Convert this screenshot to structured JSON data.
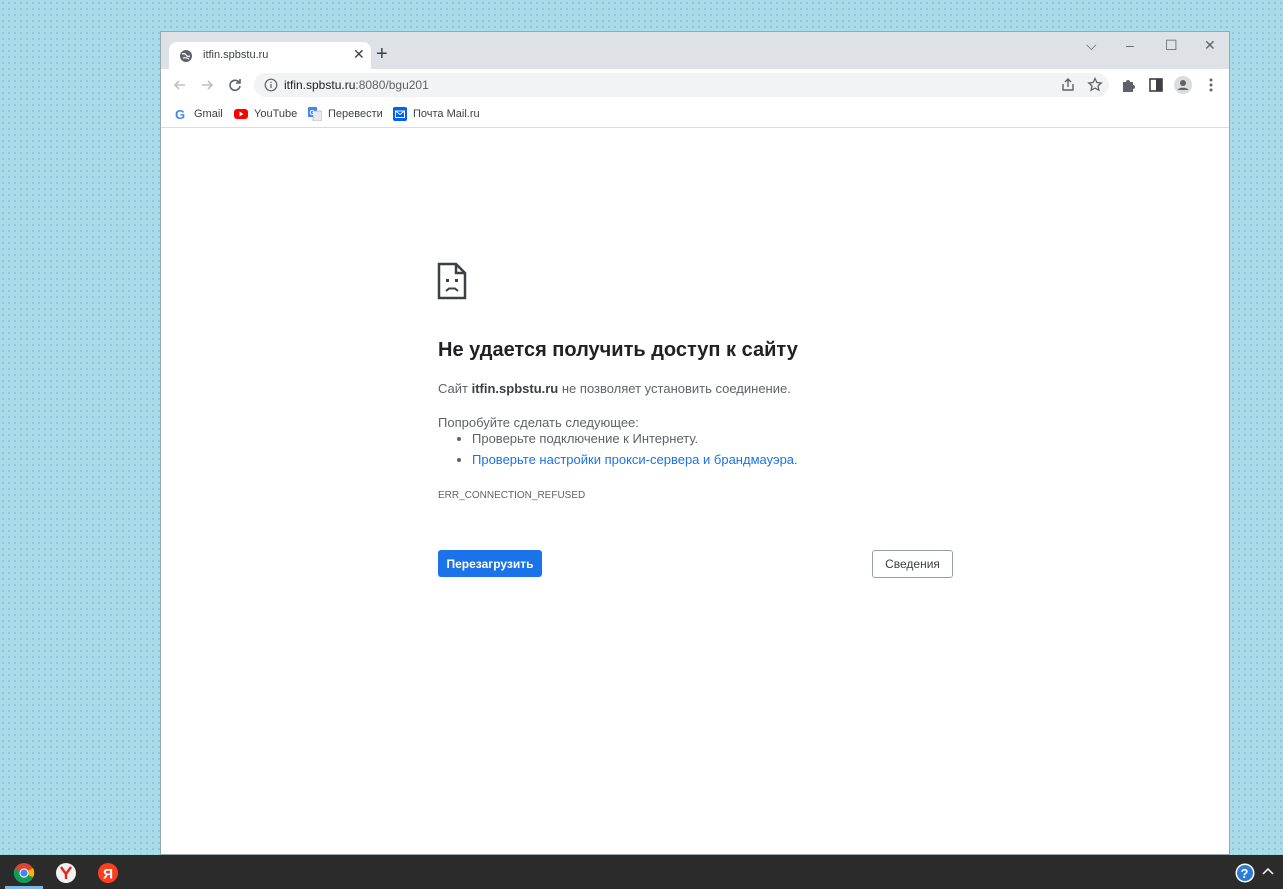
{
  "browser": {
    "tab": {
      "title": "itfin.spbstu.ru"
    },
    "new_tab": "+",
    "address": {
      "host": "itfin.spbstu.ru",
      "path": ":8080/bgu201"
    },
    "bookmarks": [
      {
        "label": "Gmail",
        "icon": "gmail-icon"
      },
      {
        "label": "YouTube",
        "icon": "youtube-icon"
      },
      {
        "label": "Перевести",
        "icon": "translate-icon"
      },
      {
        "label": "Почта Mail.ru",
        "icon": "mail-icon"
      }
    ]
  },
  "error": {
    "title": "Не удается получить доступ к сайту",
    "desc_prefix": "Сайт ",
    "desc_host": "itfin.spbstu.ru",
    "desc_suffix": " не позволяет установить соединение.",
    "try_heading": "Попробуйте сделать следующее:",
    "suggestions": [
      "Проверьте подключение к Интернету.",
      "Проверьте настройки прокси-сервера и брандмауэра"
    ],
    "suggestion_suffix": ".",
    "code": "ERR_CONNECTION_REFUSED",
    "reload_label": "Перезагрузить",
    "details_label": "Сведения"
  },
  "taskbar": {
    "apps": [
      "chrome-icon",
      "yandex-browser-icon",
      "yandex-icon"
    ]
  },
  "colors": {
    "accent": "#1a73e8",
    "link": "#1a73e8",
    "taskbar": "#2b2b2b"
  }
}
